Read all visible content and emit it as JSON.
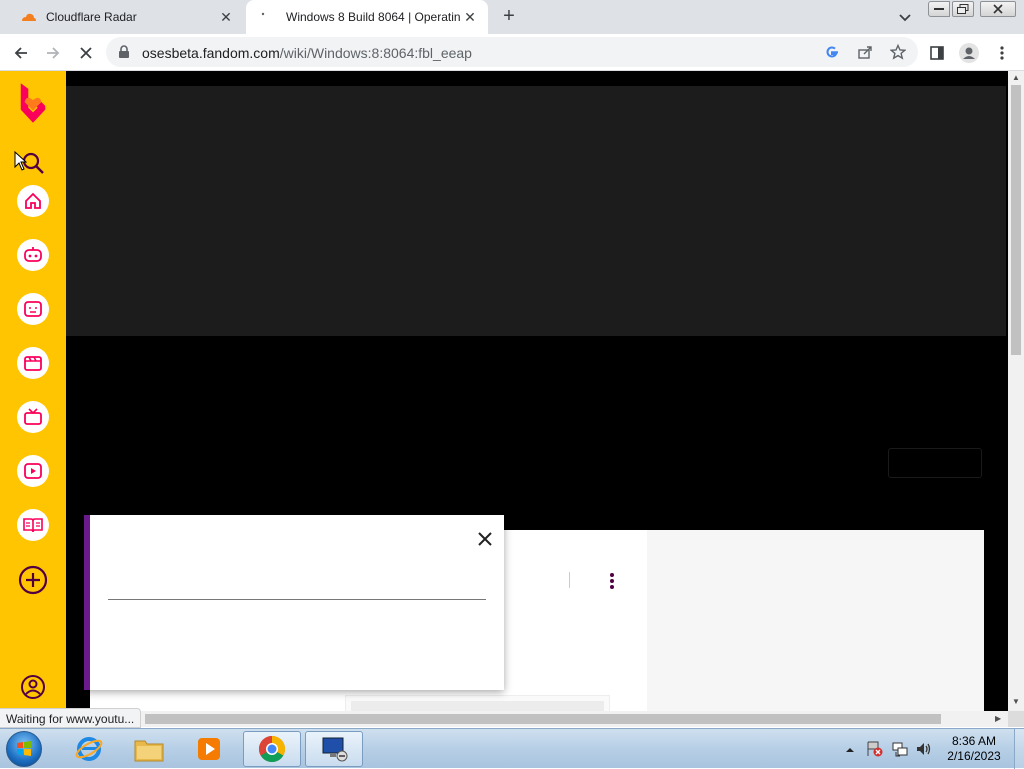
{
  "browser": {
    "tabs": [
      {
        "title": "Cloudflare Radar",
        "active": false,
        "favicon": "cloudflare-icon"
      },
      {
        "title": "Windows 8 Build 8064 | Operatin",
        "active": true,
        "favicon": "loading-icon"
      }
    ],
    "url": {
      "host": "osesbeta.fandom.com",
      "path": "/wiki/Windows:8:8064:fbl_eeap"
    },
    "status_text": "Waiting for www.youtu..."
  },
  "sidebar": {
    "items": [
      {
        "icon": "fandom-logo"
      },
      {
        "icon": "search-icon"
      },
      {
        "icon": "home-icon"
      },
      {
        "icon": "games-icon"
      },
      {
        "icon": "anime-icon"
      },
      {
        "icon": "movies-icon"
      },
      {
        "icon": "tv-icon"
      },
      {
        "icon": "video-icon"
      },
      {
        "icon": "wiki-icon"
      },
      {
        "icon": "add-icon"
      },
      {
        "icon": "user-icon"
      }
    ],
    "accent": "#ffc500",
    "icon_color": "#fa005a"
  },
  "modal": {
    "accent": "#6a1a8a"
  },
  "taskbar": {
    "apps": [
      "internet-explorer-icon",
      "file-explorer-icon",
      "media-player-icon",
      "chrome-icon",
      "remote-desktop-icon"
    ],
    "clock": {
      "time": "8:36 AM",
      "date": "2/16/2023"
    }
  }
}
